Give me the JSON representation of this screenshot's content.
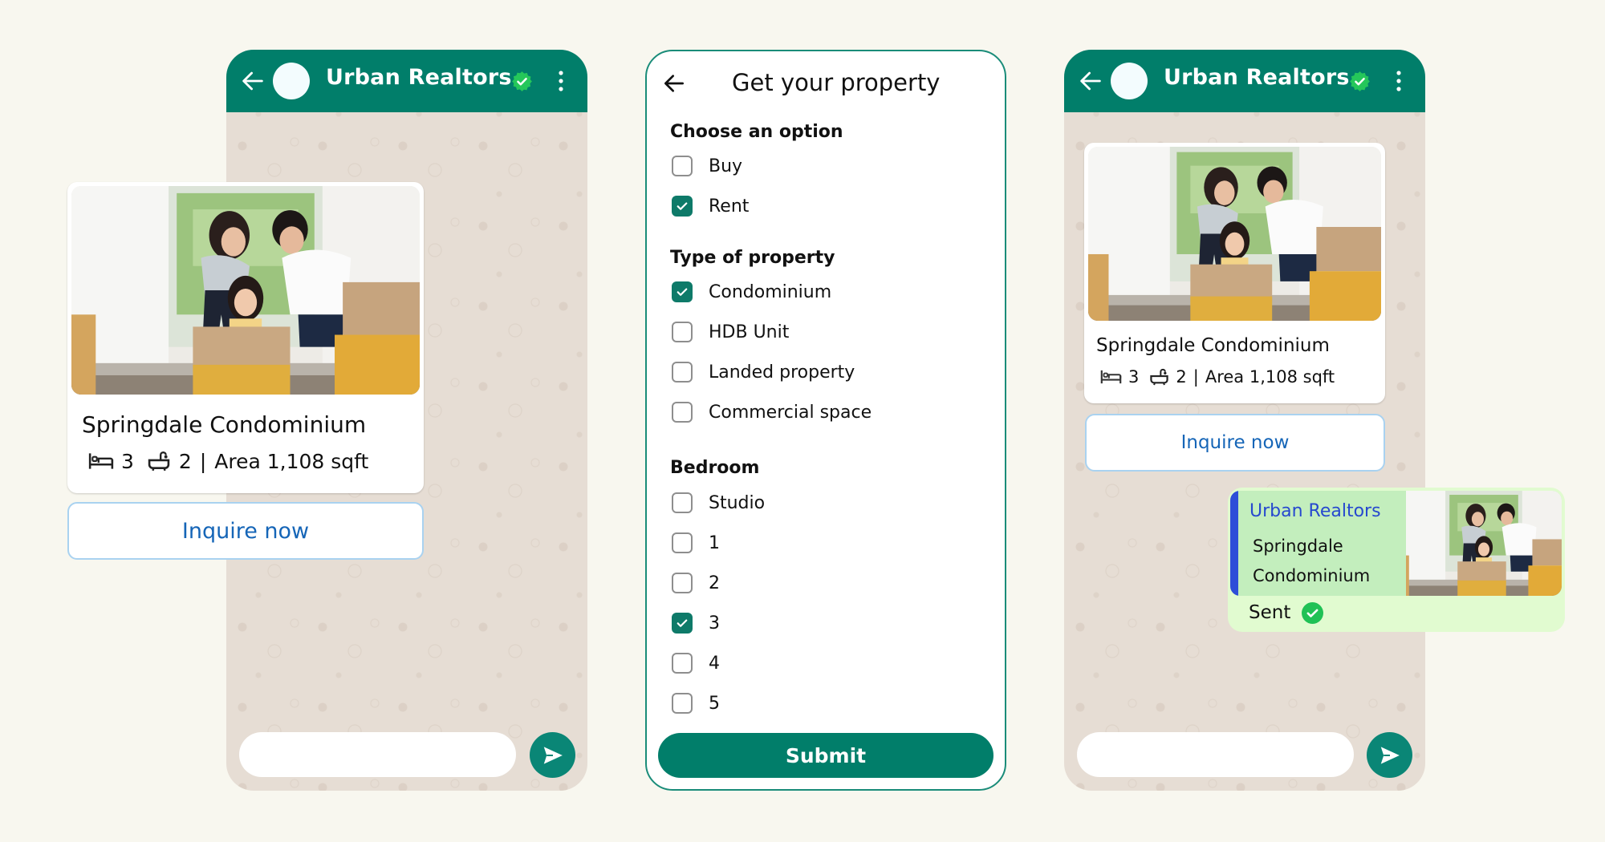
{
  "colors": {
    "page_background": "#F8F7EF",
    "header_green": "#017E6A",
    "chat_wallpaper": "#E6DDD4",
    "verified_badge": "#25C75A",
    "checkbox_checked": "#0E7A69",
    "link_blue": "#1565B7",
    "reply_bubble": "#E1FBD0",
    "quote_bar": "#2E4ED8"
  },
  "left_phone": {
    "header": {
      "back_icon": "arrow-left-icon",
      "avatar": "avatar",
      "title": "Urban Realtors",
      "verified_icon": "verified-badge-icon",
      "menu_icon": "more-vertical-icon"
    },
    "card": {
      "title": "Springdale Condominium",
      "bedrooms": "3",
      "bathrooms": "2",
      "separator": "|",
      "area": "Area 1,108 sqft",
      "bed_icon": "bed-icon",
      "bath_icon": "bathtub-icon"
    },
    "cta": "Inquire now",
    "composer": {
      "placeholder": "",
      "value": ""
    },
    "send_icon": "send-icon"
  },
  "form": {
    "back_icon": "arrow-left-icon",
    "title": "Get your property",
    "sections": [
      {
        "label": "Choose an option",
        "options": [
          {
            "label": "Buy",
            "checked": false
          },
          {
            "label": "Rent",
            "checked": true
          }
        ]
      },
      {
        "label": "Type of property",
        "options": [
          {
            "label": "Condominium",
            "checked": true
          },
          {
            "label": "HDB Unit",
            "checked": false
          },
          {
            "label": "Landed property",
            "checked": false
          },
          {
            "label": "Commercial space",
            "checked": false
          }
        ]
      },
      {
        "label": "Bedroom",
        "options": [
          {
            "label": "Studio",
            "checked": false
          },
          {
            "label": "1",
            "checked": false
          },
          {
            "label": "2",
            "checked": false
          },
          {
            "label": "3",
            "checked": true
          },
          {
            "label": "4",
            "checked": false
          },
          {
            "label": "5",
            "checked": false
          }
        ]
      }
    ],
    "submit": "Submit"
  },
  "right_phone": {
    "header": {
      "back_icon": "arrow-left-icon",
      "avatar": "avatar",
      "title": "Urban Realtors",
      "verified_icon": "verified-badge-icon",
      "menu_icon": "more-vertical-icon"
    },
    "card": {
      "title": "Springdale Condominium",
      "bedrooms": "3",
      "bathrooms": "2",
      "separator": "|",
      "area": "Area 1,108 sqft",
      "bed_icon": "bed-icon",
      "bath_icon": "bathtub-icon"
    },
    "cta": "Inquire now",
    "reply": {
      "quoted_author": "Urban Realtors",
      "quoted_line_1": "Springdale",
      "quoted_line_2": "Condominium",
      "status": "Sent",
      "status_icon": "check-circle-icon"
    },
    "composer": {
      "placeholder": "",
      "value": ""
    },
    "send_icon": "send-icon"
  }
}
